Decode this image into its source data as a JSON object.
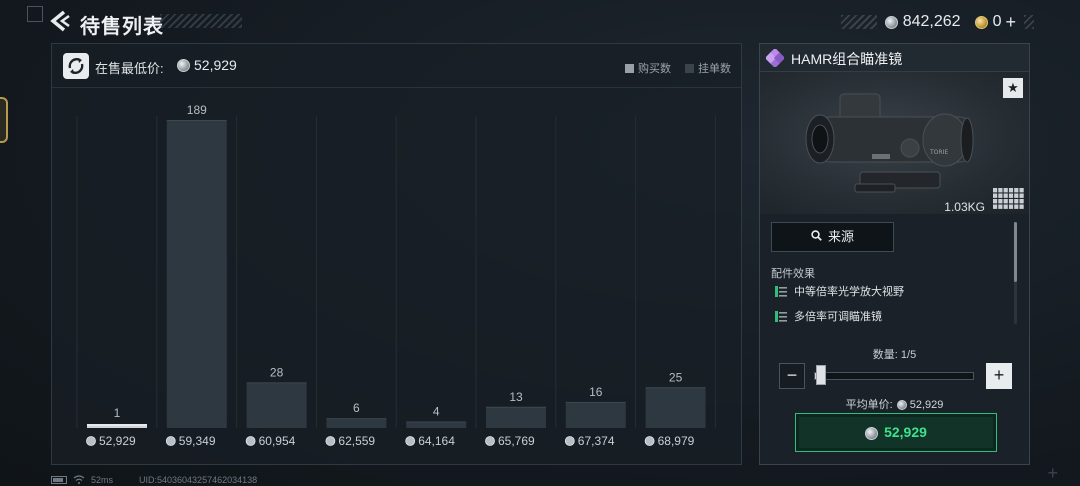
{
  "header": {
    "title": "待售列表",
    "silver_balance": "842,262",
    "gold_balance": "0",
    "plus_label": "+"
  },
  "chart_panel": {
    "lowest_label": "在售最低价:",
    "lowest_price": "52,929",
    "legend": [
      {
        "label": "购买数",
        "color": "#9aa1a6"
      },
      {
        "label": "挂单数",
        "color": "#3a444c"
      }
    ]
  },
  "chart_data": {
    "type": "bar",
    "categories": [
      "52,929",
      "59,349",
      "60,954",
      "62,559",
      "64,164",
      "65,769",
      "67,374",
      "68,979"
    ],
    "series": [
      {
        "name": "挂单数",
        "values": [
          1,
          189,
          28,
          6,
          4,
          13,
          16,
          25
        ]
      }
    ],
    "ylim": [
      0,
      189
    ],
    "grid": true
  },
  "item": {
    "name": "HAMR组合瞄准镜",
    "weight": "1.03KG",
    "fav_icon": "★",
    "source_label": "来源",
    "effects_title": "配件效果",
    "effects": [
      "中等倍率光学放大视野",
      "多倍率可调瞄准镜"
    ],
    "quantity_label": "数量: 1/5",
    "quantity_fraction": 0.2,
    "minus_label": "−",
    "plus_label": "+",
    "avg_price_label": "平均单价:",
    "avg_price": "52,929",
    "buy_price": "52,929"
  },
  "status": {
    "ping": "52ms",
    "uid": "UID:5403604325746203413​8"
  }
}
